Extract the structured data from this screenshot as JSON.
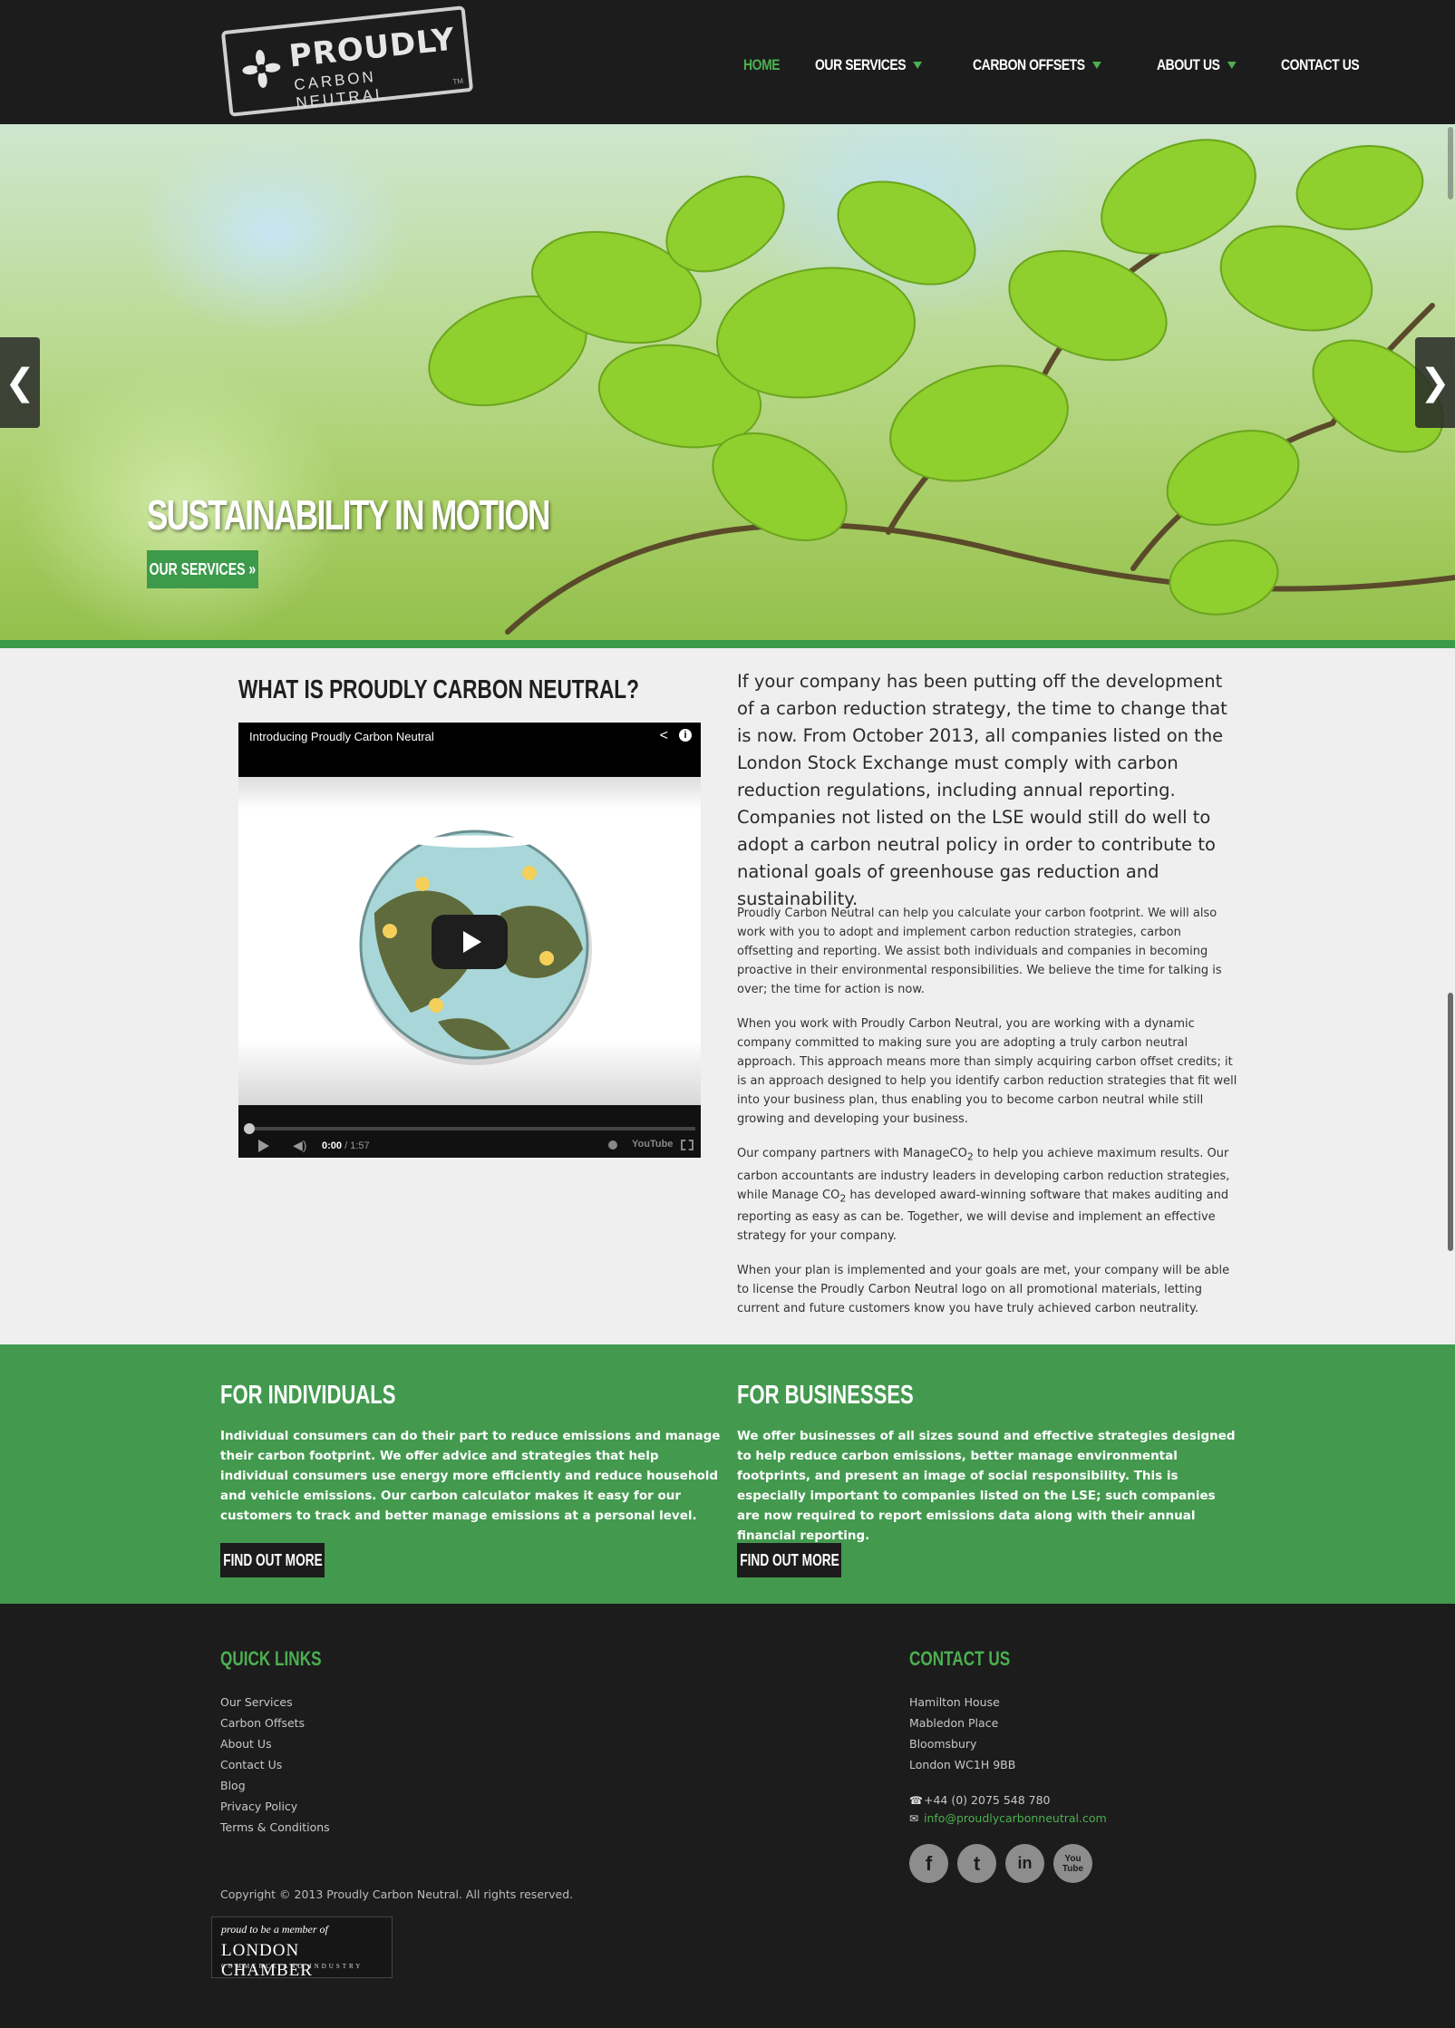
{
  "logo": {
    "brand": "PROUDLY",
    "sub": "CARBON NEUTRAL",
    "tm": "TM"
  },
  "nav": {
    "home": "HOME",
    "services": "OUR SERVICES",
    "offsets": "CARBON OFFSETS",
    "about": "ABOUT US",
    "contact": "CONTACT US"
  },
  "hero": {
    "title": "SUSTAINABILITY IN MOTION",
    "button": "OUR SERVICES »",
    "prev": "❮",
    "next": "❯"
  },
  "what": {
    "title": "WHAT IS PROUDLY CARBON NEUTRAL?",
    "video_title": "Introducing Proudly Carbon Neutral",
    "time_current": "0:00",
    "time_total": " / 1:57",
    "yt": "YouTube"
  },
  "intro": "If your company has been putting off the development of a carbon reduction strategy, the time to change that is now. From October 2013, all companies listed on the London Stock Exchange must comply with carbon reduction regulations, including annual reporting. Companies not listed on the LSE would still do well to adopt a carbon neutral policy in order to contribute to national goals of greenhouse gas reduction and sustainability.",
  "paragraphs": {
    "p1": "Proudly Carbon Neutral can help you calculate your carbon footprint. We will also work with you to adopt and implement carbon reduction strategies, carbon offsetting and reporting. We assist both individuals and companies in becoming proactive in their environmental responsibilities. We believe the time for talking is over; the time for action is now.",
    "p2": "When you work with Proudly Carbon Neutral, you are working with a dynamic company committed to making sure you are adopting a truly carbon neutral approach. This approach means more than simply acquiring carbon offset credits; it is an approach designed to help you identify carbon reduction strategies that fit well into your business plan, thus enabling you to become carbon neutral while still growing and developing your business.",
    "p3_a": "Our company partners with ManageCO",
    "p3_b": " to help you achieve maximum results. Our carbon accountants are industry leaders in developing carbon reduction strategies, while Manage CO",
    "p3_c": " has developed award-winning software that makes auditing and reporting as easy as can be. Together, we will devise and implement an effective strategy for your company.",
    "sub2": "2",
    "p4": "When your plan is implemented and your goals are met, your company will be able to license the Proudly Carbon Neutral logo on all promotional materials, letting current and future customers know you have truly achieved carbon neutrality."
  },
  "individuals": {
    "title": "FOR INDIVIDUALS",
    "text": "Individual consumers can do their part to reduce emissions and manage their carbon footprint. We offer advice and strategies that help individual consumers use energy more efficiently and reduce household and vehicle emissions. Our carbon calculator makes it easy for our customers to track and better manage emissions at a personal level.",
    "button": "FIND OUT MORE"
  },
  "businesses": {
    "title": "FOR BUSINESSES",
    "text": "We offer businesses of all sizes sound and effective strategies designed to help reduce carbon emissions, better manage environmental footprints, and present an image of social responsibility. This is especially important to companies listed on the LSE; such companies are now required to report emissions data along with their annual financial reporting.",
    "button": "FIND OUT MORE"
  },
  "footer": {
    "quick_title": "QUICK LINKS",
    "links": [
      "Our Services",
      "Carbon Offsets",
      "About Us",
      "Contact Us",
      "Blog",
      "Privacy Policy",
      "Terms & Conditions"
    ],
    "contact_title": "CONTACT US",
    "address": [
      "Hamilton House",
      "Mabledon Place",
      "Bloomsbury",
      "London WC1H 9BB"
    ],
    "phone": "+44 (0) 2075 548 780",
    "email": "info@proudlycarbonneutral.com",
    "copyright": "Copyright © 2013 Proudly Carbon Neutral. All rights reserved.",
    "chamber_1": "proud to be a member of",
    "chamber_2": "LONDON CHAMBER",
    "chamber_3": "COMMERCE AND INDUSTRY",
    "socials": {
      "facebook": "f",
      "twitter": "t",
      "linkedin": "in",
      "youtube": "You Tube"
    }
  },
  "colors": {
    "accent": "#439a4f",
    "dark": "#1c1c1c",
    "light": "#efefef"
  }
}
